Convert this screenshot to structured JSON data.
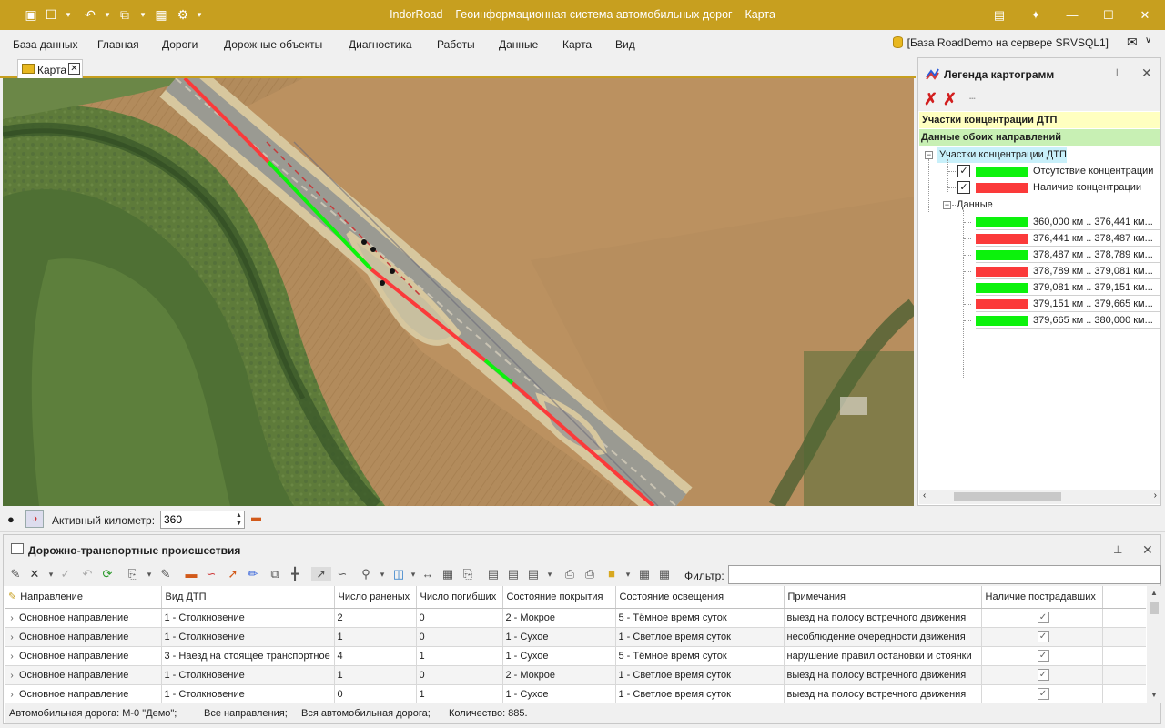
{
  "window": {
    "title": "IndorRoad – Геоинформационная система автомобильных дорог – Карта"
  },
  "menu": {
    "items": [
      "База данных",
      "Главная",
      "Дороги",
      "Дорожные объекты",
      "Диагностика",
      "Работы",
      "Данные",
      "Карта",
      "Вид"
    ],
    "database_info": "[База RoadDemo на сервере SRVSQL1]"
  },
  "tabs": [
    {
      "label": "Карта"
    }
  ],
  "legend": {
    "title": "Легенда картограмм",
    "header_yellow": "Участки концентрации ДТП",
    "header_green": "Данные обоих направлений",
    "group_label": "Участки концентрации ДТП",
    "categories": [
      {
        "label": "Отсутствие концентрации",
        "color": "#0cf20c",
        "checked": true
      },
      {
        "label": "Наличие концентрации",
        "color": "#fb3a3a",
        "checked": true
      }
    ],
    "data_label": "Данные",
    "data_items": [
      {
        "label": "360,000 км .. 376,441 км...",
        "color": "#0cf20c"
      },
      {
        "label": "376,441 км .. 378,487 км...",
        "color": "#fb3a3a"
      },
      {
        "label": "378,487 км .. 378,789 км...",
        "color": "#0cf20c"
      },
      {
        "label": "378,789 км .. 379,081 км...",
        "color": "#fb3a3a"
      },
      {
        "label": "379,081 км .. 379,151 км...",
        "color": "#0cf20c"
      },
      {
        "label": "379,151 км .. 379,665 км...",
        "color": "#fb3a3a"
      },
      {
        "label": "379,665 км .. 380,000 км...",
        "color": "#0cf20c"
      }
    ]
  },
  "kmbar": {
    "label": "Активный километр:",
    "value": "360"
  },
  "dtp": {
    "title": "Дорожно-транспортные происшествия",
    "filter_label": "Фильтр:",
    "filter_value": "",
    "columns": [
      "Направление",
      "Вид ДТП",
      "Число раненых",
      "Число погибших",
      "Состояние покрытия",
      "Состояние освещения",
      "Примечания",
      "Наличие пострадавших"
    ],
    "rows": [
      [
        "Основное направление",
        "1 - Столкновение",
        "2",
        "0",
        "2 - Мокрое",
        "5 - Тёмное время суток",
        "выезд на полосу встречного движения",
        true
      ],
      [
        "Основное направление",
        "1 - Столкновение",
        "1",
        "0",
        "1 - Сухое",
        "1 - Светлое время суток",
        "несоблюдение очередности движения",
        true
      ],
      [
        "Основное направление",
        "3 - Наезд на стоящее транспортное",
        "4",
        "1",
        "1 - Сухое",
        "5 - Тёмное время суток",
        "нарушение правил остановки и стоянки",
        true
      ],
      [
        "Основное направление",
        "1 - Столкновение",
        "1",
        "0",
        "2 - Мокрое",
        "1 - Светлое время суток",
        "выезд на полосу встречного движения",
        true
      ],
      [
        "Основное направление",
        "1 - Столкновение",
        "0",
        "1",
        "1 - Сухое",
        "1 - Светлое время суток",
        "выезд на полосу встречного движения",
        true
      ]
    ],
    "status": {
      "road": "Автомобильная дорога: М-0 \"Демо\";",
      "directions": "Все направления;",
      "scope": "Вся автомобильная дорога;",
      "count": "Количество: 885."
    }
  },
  "colors": {
    "accent": "#c79f1f",
    "concentration_absent": "#0cf20c",
    "concentration_present": "#fb3a3a"
  }
}
